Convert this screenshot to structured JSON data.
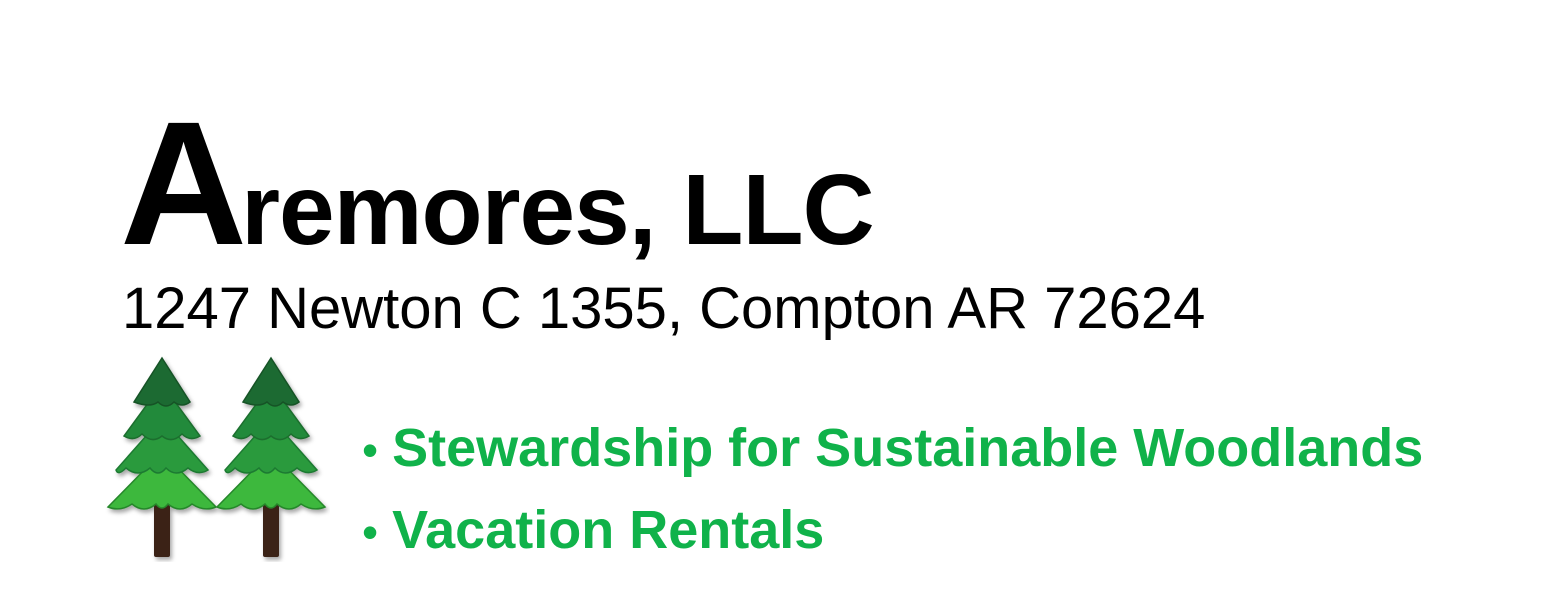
{
  "header": {
    "title_initial": "A",
    "title_rest": "remores, LLC",
    "address": "1247 Newton C 1355, Compton AR 72624"
  },
  "logo": {
    "icon": "pine-trees-icon",
    "colors": {
      "dark_green": "#1e6b32",
      "mid_green": "#2a9a3e",
      "light_green": "#3cb83e",
      "trunk": "#3a2416"
    }
  },
  "services": {
    "bullet": "•",
    "items": [
      {
        "label": "Stewardship for Sustainable Woodlands"
      },
      {
        "label": "Vacation Rentals"
      }
    ],
    "color": "#10b24a"
  }
}
